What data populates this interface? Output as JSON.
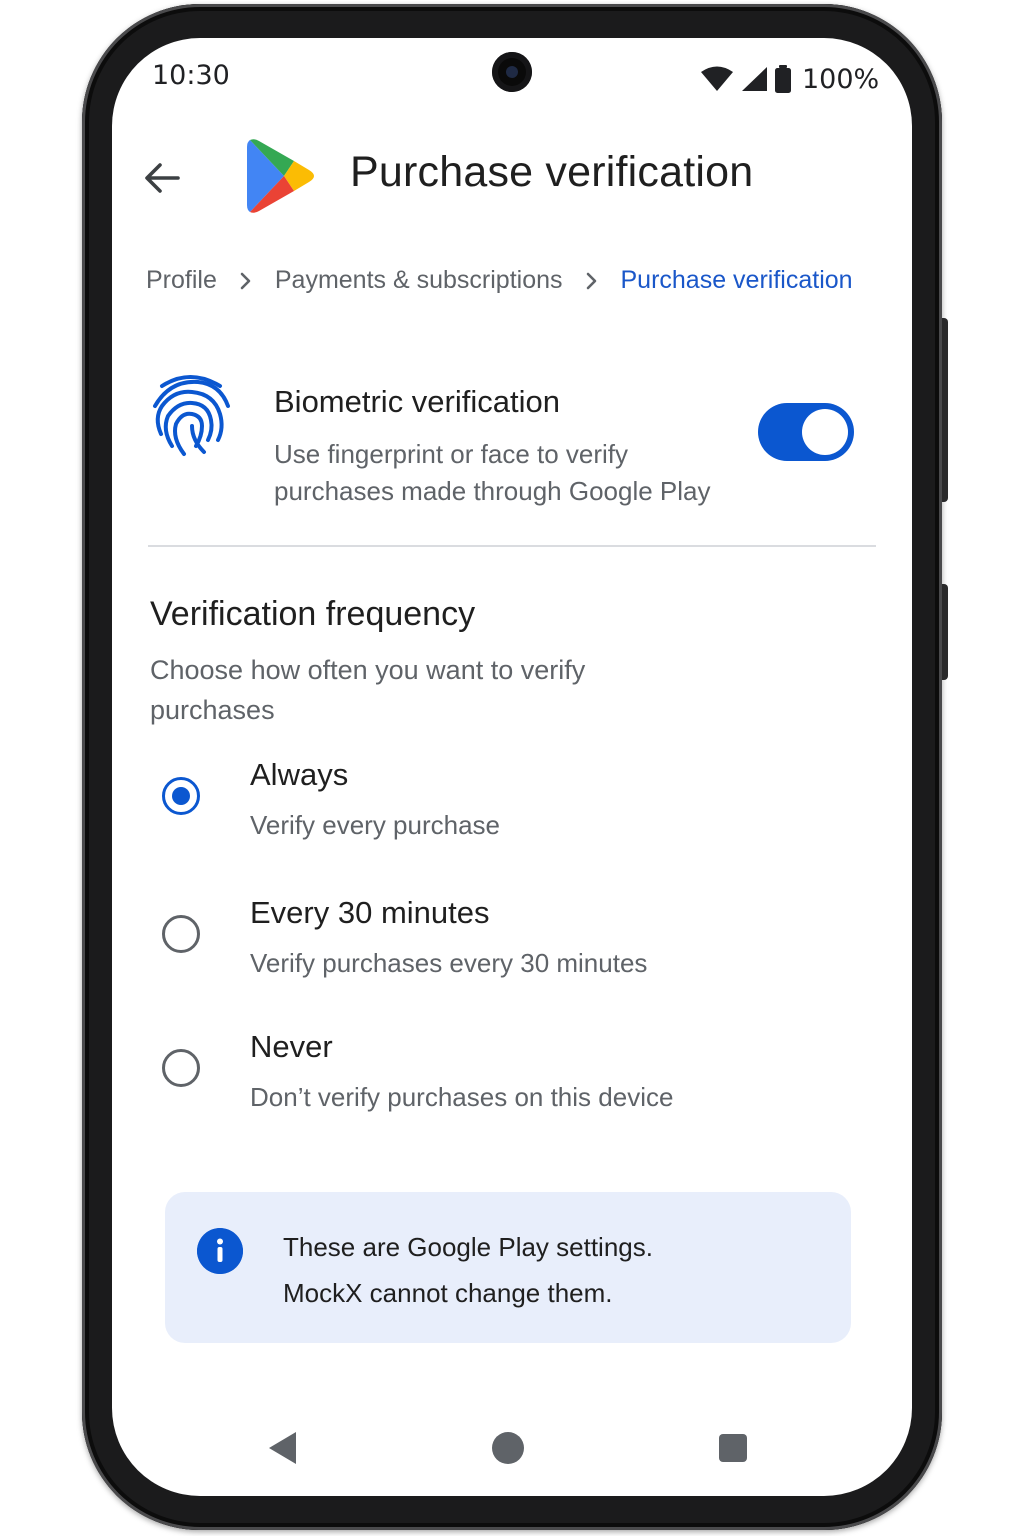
{
  "status_bar": {
    "time": "10:30",
    "battery": "100%",
    "icons": [
      "wifi-icon",
      "cell-signal-icon",
      "battery-icon"
    ]
  },
  "app_bar": {
    "back_icon": "arrow-back-icon",
    "logo": "google-play-logo",
    "title": "Purchase verification"
  },
  "breadcrumb": {
    "items": [
      "Profile",
      "Payments & subscriptions",
      "Purchase verification"
    ],
    "separator_icon": "chevron-right-icon"
  },
  "biometric": {
    "icon": "fingerprint-icon",
    "title": "Biometric verification",
    "description": "Use fingerprint or face to verify purchases made through Google Play",
    "enabled": true
  },
  "frequency": {
    "title": "Verification frequency",
    "description": "Choose how often you want to verify purchases",
    "options": [
      {
        "title": "Always",
        "description": "Verify every purchase",
        "selected": true
      },
      {
        "title": "Every 30 minutes",
        "description": "Verify purchases every 30 minutes",
        "selected": false
      },
      {
        "title": "Never",
        "description": "Don’t verify purchases on this device",
        "selected": false
      }
    ]
  },
  "info": {
    "icon": "info-icon",
    "lines": [
      "These are Google Play settings.",
      "MockX cannot change them."
    ]
  },
  "nav_bar": {
    "buttons": [
      "nav-back-icon",
      "nav-home-icon",
      "nav-recents-icon"
    ]
  },
  "colors": {
    "accent": "#0b57d0",
    "link": "#1a57c9",
    "info_bg": "#e8eefb",
    "text_primary": "#1f1f1f",
    "text_secondary": "#5f6368"
  }
}
